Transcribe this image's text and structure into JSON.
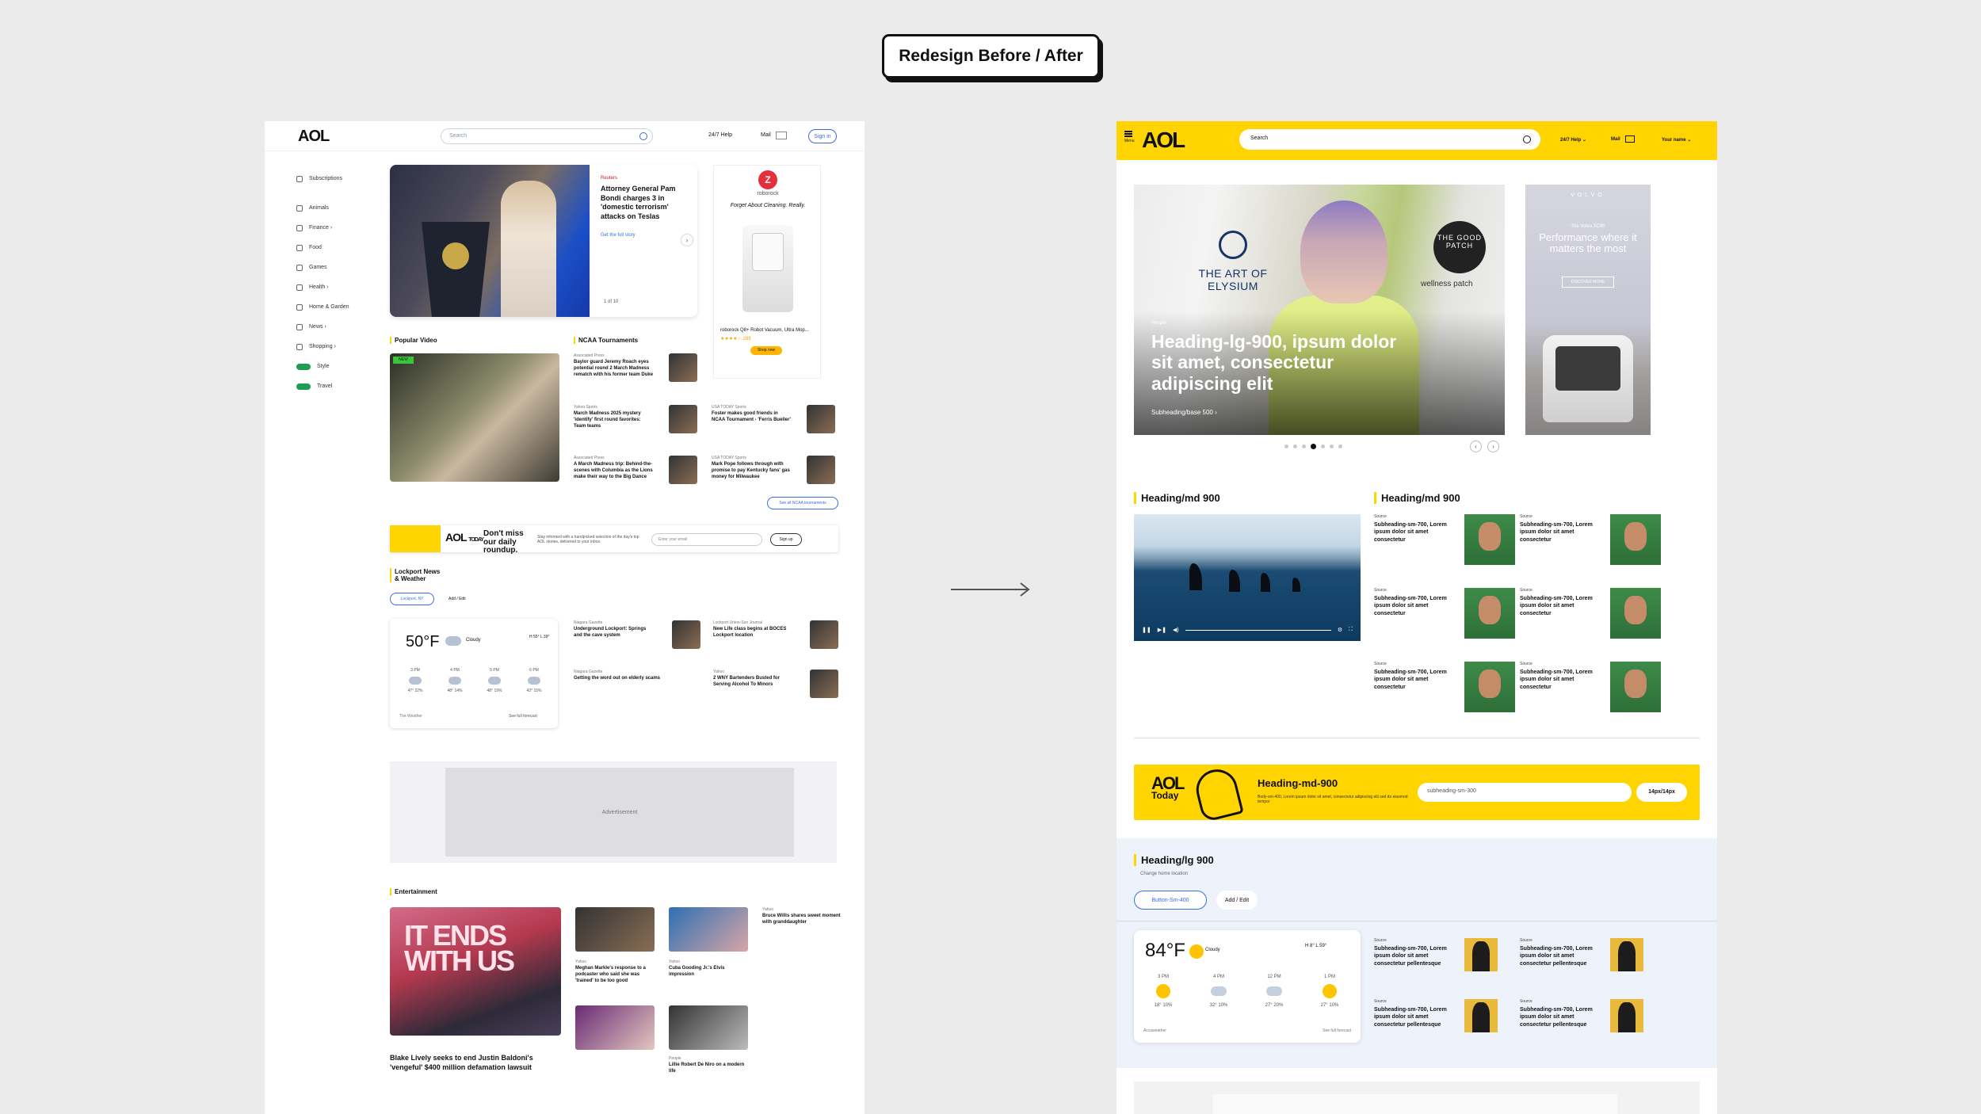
{
  "page_title": "Redesign Before / After",
  "before": {
    "header": {
      "logo": "AOL",
      "search_placeholder": "Search",
      "help": "24/7 Help",
      "mail": "Mail",
      "signin": "Sign in"
    },
    "sidebar": [
      {
        "label": "Subscriptions",
        "icon": "star-icon"
      },
      {
        "label": "Animals",
        "icon": "paw-icon"
      },
      {
        "label": "Finance  ›",
        "icon": "chart-icon"
      },
      {
        "label": "Food",
        "icon": "food-icon"
      },
      {
        "label": "Games",
        "icon": "gamepad-icon"
      },
      {
        "label": "Health  ›",
        "icon": "heart-icon"
      },
      {
        "label": "Home & Garden",
        "icon": "home-icon"
      },
      {
        "label": "News  ›",
        "icon": "news-icon"
      },
      {
        "label": "Shopping  ›",
        "icon": "bag-icon"
      },
      {
        "label": "Style",
        "icon": "style-pill"
      },
      {
        "label": "Travel",
        "icon": "travel-pill"
      }
    ],
    "hero": {
      "source": "Reuters",
      "title": "Attorney General Pam Bondi charges 3 in 'domestic terrorism' attacks on Teslas",
      "link": "Get the full story",
      "pager": "1 of 10"
    },
    "ad_robot": {
      "logo_letter": "Z",
      "brand": "roborock",
      "tagline": "Forget About Cleaning. Really.",
      "product": "roborock Q8+ Robot Vacuum, Ultra Mop...",
      "stars": "★★★★☆ 289",
      "shop": "Shop now"
    },
    "popular_video": {
      "heading": "Popular Video",
      "badge": "NEW"
    },
    "ncaa": {
      "heading": "NCAA Tournaments",
      "items": [
        {
          "source": "Associated Press",
          "title": "Baylor guard Jeremy Roach eyes potential round 2 March Madness rematch with his former team Duke"
        },
        {
          "source": "Yahoo Sports",
          "title": "March Madness 2025 mystery 'identify' first round favorites: Team teams"
        },
        {
          "source": "USA TODAY Sports",
          "title": "Foster makes good friends in NCAA Tournament - 'Ferris Bueller'"
        },
        {
          "source": "Associated Press",
          "title": "A March Madness trip: Behind-the-scenes with Columbia as the Lions make their way to the Big Dance"
        },
        {
          "source": "USA TODAY Sports",
          "title": "Mark Pope follows through with promise to pay Kentucky fans' gas money for Milwaukee"
        }
      ],
      "see_all": "See all NCAA tournaments"
    },
    "today": {
      "logo": "AOL",
      "logo_sub": "TODAY",
      "heading": "Don't miss our daily roundup.",
      "desc": "Stay informed with a handpicked selection of the day's top AOL stories, delivered to your inbox.",
      "input_placeholder": "Enter your email",
      "button": "Sign up"
    },
    "local": {
      "heading": "Lockport News & Weather",
      "tab1": "Lockport, NY",
      "tab2": "Add / Edit",
      "weather": {
        "temp": "50°F",
        "cond": "Cloudy",
        "hl": "H 55° L 39°",
        "days": [
          {
            "d": "3 PM",
            "t": "47° 22%"
          },
          {
            "d": "4 PM",
            "t": "48° 14%"
          },
          {
            "d": "5 PM",
            "t": "48° 19%"
          },
          {
            "d": "6 PM",
            "t": "43° 15%"
          }
        ],
        "footer_left": "The Weather",
        "footer_right": "See full forecast"
      },
      "items": [
        {
          "source": "Niagara Gazette",
          "title": "Underground Lockport: Springs and the cave system"
        },
        {
          "source": "Lockport Union-Sun Journal",
          "title": "New Life class begins at BOCES Lockport location"
        },
        {
          "source": "Niagara Gazette",
          "title": "Getting the word out on elderly scams"
        },
        {
          "source": "Yahoo",
          "title": "2 WNY Bartenders Busted for Serving Alcohol To Minors"
        }
      ]
    },
    "advertisement": "Advertisement",
    "entertainment": {
      "heading": "Entertainment",
      "hero_text": "IT ENDS WITH US",
      "main_title": "Blake Lively seeks to end Justin Baldoni's 'vengeful' $400 million defamation lawsuit",
      "items": [
        {
          "source": "Yahoo",
          "title": "Bruce Willis shares sweet moment with granddaughter"
        },
        {
          "source": "Yahoo",
          "title": "Meghan Markle's response to a podcaster who said she was 'trained' to be too good"
        },
        {
          "source": "Yahoo",
          "title": "Cuba Gooding Jr.'s Elvis impression"
        },
        {
          "source": "People",
          "title": "Lillie Robert De Niro on a modern life"
        }
      ]
    }
  },
  "after": {
    "header": {
      "menu": "Menu",
      "logo": "AOL",
      "search_placeholder": "Search",
      "help": "24/7 Help",
      "mail": "Mail",
      "your_name": "Your name"
    },
    "hero": {
      "art_text": "THE ART OF ELYSIUM",
      "patch": "THE GOOD PATCH",
      "patch_sub": "wellness patch",
      "source": "People",
      "title": "Heading-lg-900, ipsum dolor sit amet, consectetur adipiscing elit",
      "subheading": "Subheading/base 500  ›",
      "prev": "‹",
      "next": "›"
    },
    "volvo": {
      "brand": "VOLVO",
      "sub": "The Volvo XC90",
      "headline": "Performance where it matters the most",
      "button": "DISCOVER MORE"
    },
    "video_section": {
      "heading": "Heading/md 900"
    },
    "news_section": {
      "heading": "Heading/md 900",
      "cards": [
        {
          "source": "Source",
          "title": "Subheading-sm-700, Lorem ipsum dolor sit amet consectetur"
        },
        {
          "source": "Source",
          "title": "Subheading-sm-700, Lorem ipsum dolor sit amet consectetur"
        },
        {
          "source": "Source",
          "title": "Subheading-sm-700, Lorem ipsum dolor sit amet consectetur"
        },
        {
          "source": "Source",
          "title": "Subheading-sm-700, Lorem ipsum dolor sit amet consectetur"
        },
        {
          "source": "Source",
          "title": "Subheading-sm-700, Lorem ipsum dolor sit amet consectetur"
        },
        {
          "source": "Source",
          "title": "Subheading-sm-700, Lorem ipsum dolor sit amet consectetur"
        }
      ]
    },
    "today": {
      "logo": "AOL",
      "logo_sub": "Today",
      "heading": "Heading-md-900",
      "desc": "Body-sm-400, Lorem ipsum dolor sit amet, consectetur adipiscing elit sed do eiusmod tempor",
      "input_placeholder": "subheading-sm-300",
      "button": "14px/14px"
    },
    "local": {
      "heading": "Heading/lg 900",
      "location": "Change home location",
      "tab1": "Button-Sm-400",
      "tab2": "Add / Edit",
      "weather": {
        "temp": "84°F",
        "cond": "Cloudy",
        "hl": "H 8° L 59°",
        "days": [
          {
            "d": "3 PM",
            "t": "18° 10%",
            "icon": "sun"
          },
          {
            "d": "4 PM",
            "t": "32° 10%",
            "icon": "cloud"
          },
          {
            "d": "12 PM",
            "t": "27° 20%",
            "icon": "cloud"
          },
          {
            "d": "1 PM",
            "t": "27° 10%",
            "icon": "sun"
          }
        ],
        "footer_left": "Accuweather",
        "footer_right": "See full forecast"
      },
      "cards": [
        {
          "source": "Source",
          "title": "Subheading-sm-700, Lorem ipsum dolor sit amet consectetur pellentesque"
        },
        {
          "source": "Source",
          "title": "Subheading-sm-700, Lorem ipsum dolor sit amet consectetur pellentesque"
        },
        {
          "source": "Source",
          "title": "Subheading-sm-700, Lorem ipsum dolor sit amet consectetur pellentesque"
        },
        {
          "source": "Source",
          "title": "Subheading-sm-700, Lorem ipsum dolor sit amet consectetur pellentesque"
        }
      ]
    }
  }
}
